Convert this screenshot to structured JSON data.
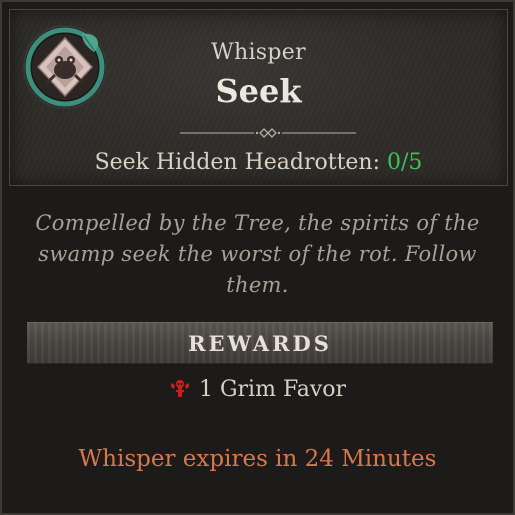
{
  "header": {
    "quest_type": "Whisper",
    "quest_name": "Seek",
    "objective_label": "Seek Hidden Headrotten:",
    "objective_progress": "0/5",
    "emblem_icon": "bone-frog-emblem-icon"
  },
  "description": "Compelled by the Tree, the spirits of the swamp seek the worst of the rot. Follow them.",
  "rewards": {
    "title": "REWARDS",
    "items": [
      {
        "icon": "grim-favor-icon",
        "label": "1 Grim Favor"
      }
    ]
  },
  "expiry": "Whisper expires in 24 Minutes",
  "colors": {
    "progress": "#3fc251",
    "expiry": "#d7774e",
    "emblem_ring": "#3c8e7e",
    "reward_icon": "#c81e1e"
  }
}
